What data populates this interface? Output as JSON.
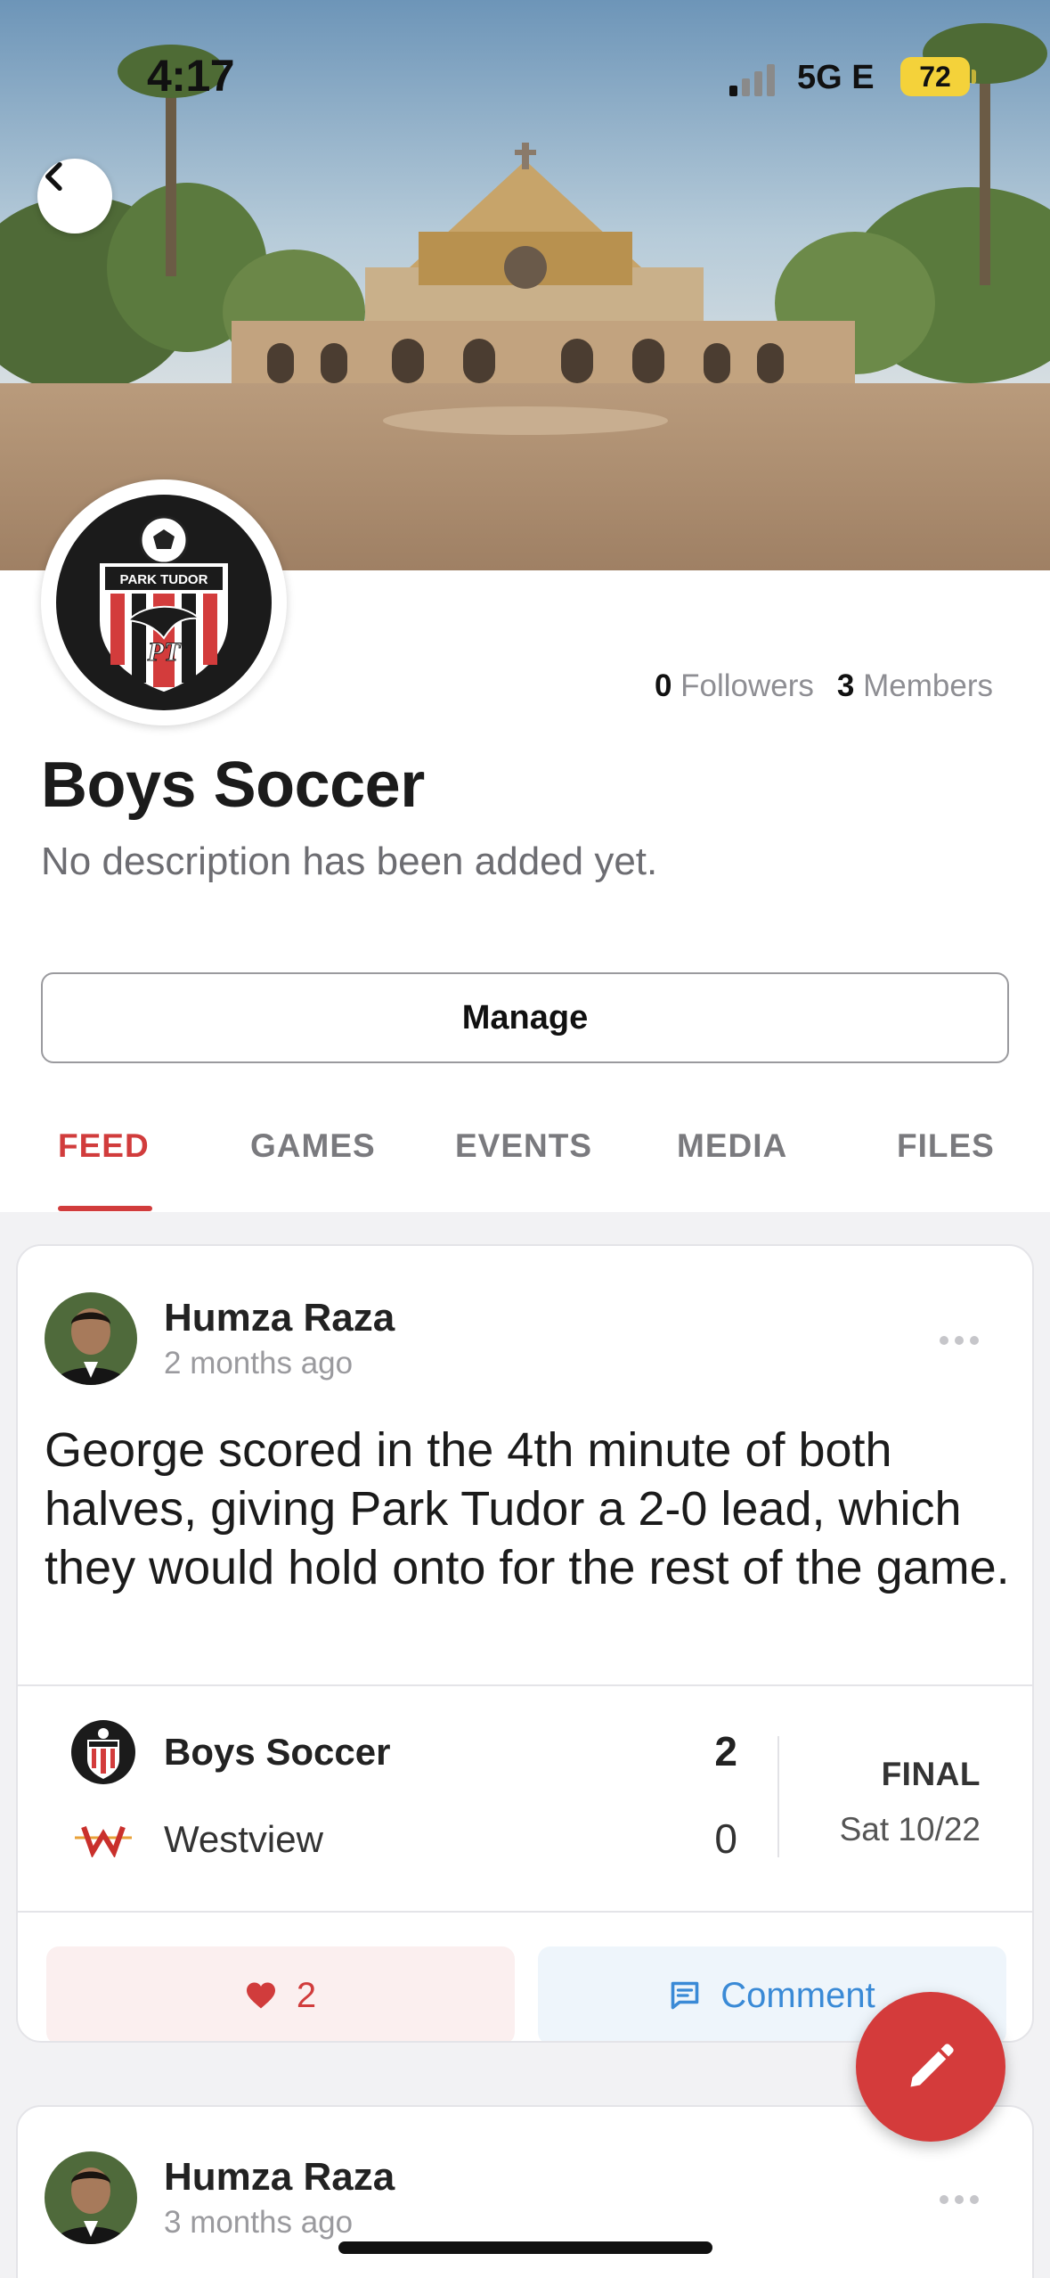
{
  "status_bar": {
    "time": "4:17",
    "network": "5G E",
    "battery": "72"
  },
  "team": {
    "name": "Boys Soccer",
    "description": "No description has been added yet.",
    "followers_count": "0",
    "followers_label": "Followers",
    "members_count": "3",
    "members_label": "Members",
    "logo_text": "PARK TUDOR",
    "logo_initials": "PT"
  },
  "manage_label": "Manage",
  "tabs": [
    {
      "label": "FEED",
      "active": true
    },
    {
      "label": "GAMES",
      "active": false
    },
    {
      "label": "EVENTS",
      "active": false
    },
    {
      "label": "MEDIA",
      "active": false
    },
    {
      "label": "FILES",
      "active": false
    }
  ],
  "posts": [
    {
      "author": "Humza Raza",
      "time": "2 months ago",
      "body": "George scored in the 4th minute of both halves, giving Park Tudor a 2-0 lead, which they would hold onto for the rest of the game.",
      "game": {
        "home_team": "Boys Soccer",
        "home_score": "2",
        "away_team": "Westview",
        "away_score": "0",
        "status": "FINAL",
        "date": "Sat 10/22"
      },
      "likes": "2",
      "comment_label": "Comment"
    },
    {
      "author": "Humza Raza",
      "time": "3 months ago"
    }
  ],
  "colors": {
    "accent_red": "#d13c3c",
    "comment_blue": "#3a8ad6",
    "battery_yellow": "#f4d23a"
  },
  "icons": {
    "back": "chevron-left-icon",
    "more": "more-horizontal-icon",
    "like": "heart-icon",
    "comment": "comment-icon",
    "compose": "pencil-icon"
  }
}
